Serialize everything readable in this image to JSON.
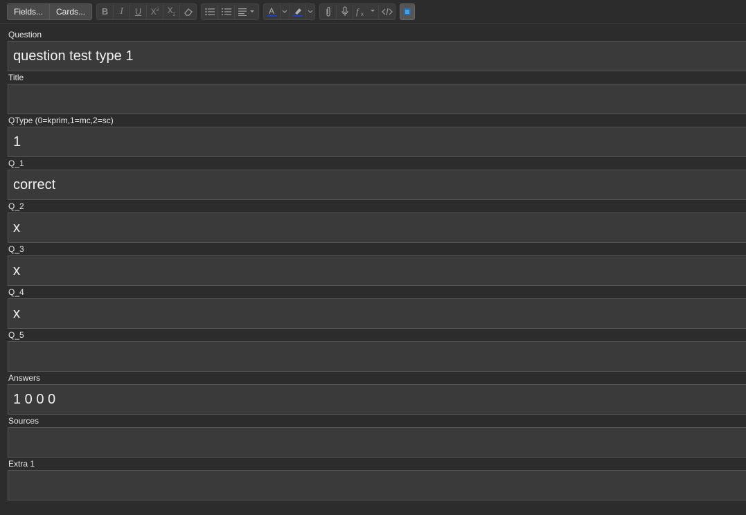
{
  "toolbar": {
    "fields_label": "Fields...",
    "cards_label": "Cards...",
    "icons": {
      "bold": "bold-icon",
      "italic": "italic-icon",
      "underline": "underline-icon",
      "superscript": "superscript-icon",
      "subscript": "subscript-icon",
      "eraser": "eraser-icon",
      "bullet_list": "bullet-list-icon",
      "numbered_list": "numbered-list-icon",
      "align": "align-icon",
      "text_color": "text-color-icon",
      "highlight": "highlight-icon",
      "attach": "paperclip-icon",
      "record": "microphone-icon",
      "math": "function-icon",
      "html": "html-code-icon",
      "sticky": "pin-icon"
    },
    "text_color_bar": "#1f3fbf",
    "highlight_color_bar": "#1f3fbf"
  },
  "fields": [
    {
      "label": "Question",
      "value": "question test type 1"
    },
    {
      "label": "Title",
      "value": ""
    },
    {
      "label": "QType (0=kprim,1=mc,2=sc)",
      "value": "1"
    },
    {
      "label": "Q_1",
      "value": "correct"
    },
    {
      "label": "Q_2",
      "value": "x"
    },
    {
      "label": "Q_3",
      "value": "x"
    },
    {
      "label": "Q_4",
      "value": "x"
    },
    {
      "label": "Q_5",
      "value": ""
    },
    {
      "label": "Answers",
      "value": "1 0 0 0"
    },
    {
      "label": "Sources",
      "value": ""
    },
    {
      "label": "Extra 1",
      "value": ""
    }
  ]
}
